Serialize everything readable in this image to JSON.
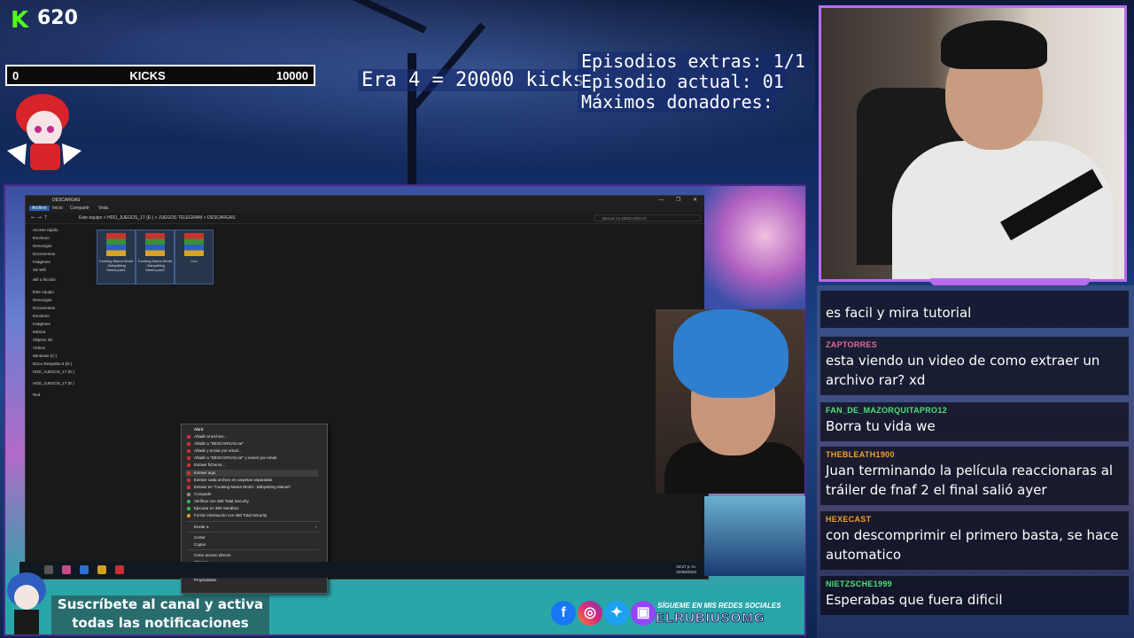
{
  "kick": {
    "brand_letter": "K",
    "count": "620",
    "bar_min": "0",
    "bar_label": "KICKS",
    "bar_max": "10000"
  },
  "overlay": {
    "era": "Era 4 = 20000 kicks",
    "episodes_extra": "Episodios extras: 1/1",
    "episode_current": "Episodio actual: 01",
    "top_donors": "Máximos donadores:"
  },
  "chat": [
    {
      "user": "",
      "user_color": "#b993ff",
      "text": "es facil y mira tutorial"
    },
    {
      "user": "ZAPTORRES",
      "user_color": "#e06a9a",
      "text": "esta viendo un video de como extraer un archivo rar? xd"
    },
    {
      "user": "FAN_DE_MAZORQUITAPRO12",
      "user_color": "#4fe07a",
      "text": "Borra tu vida we"
    },
    {
      "user": "THEBLEATH1900",
      "user_color": "#f0a030",
      "text": "Juan terminando la película reaccionaras al tráiler de fnaf 2 el final salió ayer"
    },
    {
      "user": "HEXECAST",
      "user_color": "#f0a030",
      "text": "con descomprimir el primero basta, se hace automatico"
    },
    {
      "user": "NIETZSCHE1999",
      "user_color": "#4fe07a",
      "text": "Esperabas que fuera dificil"
    }
  ],
  "explorer": {
    "title": "DESCARGAS",
    "ribbon_tabs": [
      "Archivo",
      "Inicio",
      "Compartir",
      "Vista"
    ],
    "path": "Este equipo  >  HDD_JUEGOS_1T (E:)  >  JUEGOS TELEGRAM  >  DESCARGAS",
    "search_placeholder": "Buscar en DESCARGAS",
    "nav_items": [
      "Acceso rápido",
      "Escritorio",
      "Descargas",
      "Documentos",
      "Imágenes",
      "SS Wifi",
      "wifi u fricción",
      "Este equipo",
      "Descargas",
      "Documentos",
      "Escritorio",
      "Imágenes",
      "Música",
      "Objetos 3D",
      "Vídeos",
      "Windows (C:)",
      "Disco Respaldo 8 (D:)",
      "HDD_JUEGOS_1T (E:)",
      "HDD_JUEGOS_1T (E:)",
      "Red"
    ],
    "files": [
      {
        "label": "Cooking Mama World - Babysitting Mama.part1"
      },
      {
        "label": "Cooking Mama World - Babysitting Mama.part2"
      },
      {
        "label": "Coo"
      }
    ],
    "status": "3 elementos    3 elementos seleccionados  2,93 GB",
    "context_menu": [
      "Abrir",
      "Añadir al archivo...",
      "Añadir a \"DESCARGAS.rar\"",
      "Añadir y enviar por email...",
      "Añadir a \"DESCARGAS.rar\" y enviar por email",
      "Extraer ficheros...",
      "Extraer aquí",
      "Extraer cada archivo en carpetas separadas",
      "Extraer en \"Cooking Mama World - Babysitting Mama\\\"",
      "Compartir",
      "Verificar con 360 Total Security",
      "Ejecutar en 360 Sandbox",
      "Forzar eliminación con 360 Total Security",
      "Enviar a",
      "Cortar",
      "Copiar",
      "Crear acceso directo",
      "Eliminar",
      "Cambiar nombre",
      "Propiedades"
    ],
    "clock_time": "03:27 p. m.",
    "clock_date": "02/08/2023"
  },
  "bottom": {
    "subscribe_line1": "Suscríbete al canal y activa",
    "subscribe_line2": "todas las notificaciones",
    "social_caption": "SÍGUEME EN MIS REDES SOCIALES",
    "social_handle": "ELRUBIUSOMG",
    "social_icons": [
      "facebook-icon",
      "instagram-icon",
      "twitter-icon",
      "twitch-icon"
    ]
  },
  "colors": {
    "kick_green": "#53fc18",
    "frame_purple": "#b96cf0"
  }
}
